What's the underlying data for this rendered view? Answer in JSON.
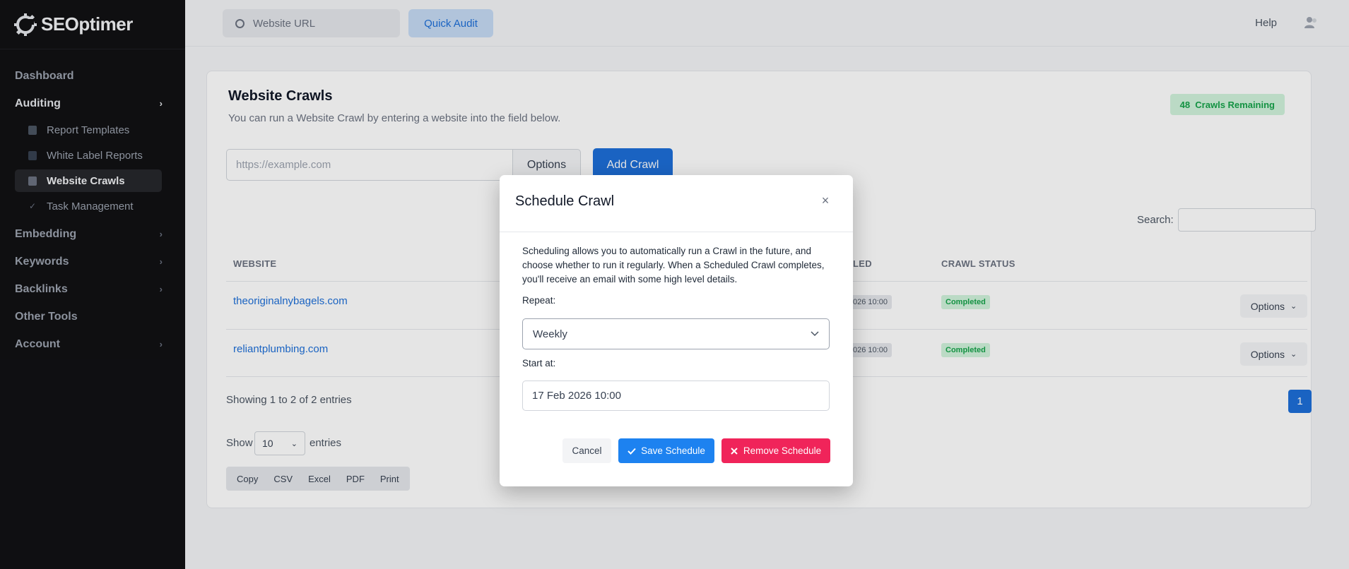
{
  "brand": {
    "name": "SEOptimer"
  },
  "sidebar": {
    "items": [
      {
        "label": "Dashboard"
      },
      {
        "label": "Auditing"
      },
      {
        "label": "Embedding"
      },
      {
        "label": "Keywords"
      },
      {
        "label": "Backlinks"
      },
      {
        "label": "Other Tools"
      },
      {
        "label": "Account"
      }
    ],
    "auditing_sub": [
      {
        "label": "Report Templates",
        "icon": "brush-icon"
      },
      {
        "label": "White Label Reports",
        "icon": "document-icon"
      },
      {
        "label": "Website Crawls",
        "icon": "crawl-search-icon"
      },
      {
        "label": "Task Management",
        "icon": "check-icon"
      }
    ]
  },
  "topbar": {
    "search_placeholder": "Website URL",
    "quick_audit_label": "Quick Audit",
    "help_label": "Help"
  },
  "page": {
    "title": "Website Crawls",
    "subtitle": "You can run a Website Crawl by entering a website into the field below.",
    "remaining_count": "48",
    "remaining_label": "Crawls Remaining",
    "url_placeholder": "https://example.com",
    "options_label": "Options",
    "add_crawl_label": "Add Crawl"
  },
  "table": {
    "search_label": "Search:",
    "columns": {
      "website": "WEBSITE",
      "scheduled_partial": "LED",
      "crawl_status": "CRAWL STATUS"
    },
    "rows": [
      {
        "website": "theoriginalnybagels.com",
        "scheduled_partial": "026 10:00",
        "status": "Completed",
        "options": "Options"
      },
      {
        "website": "reliantplumbing.com",
        "scheduled_partial": "026 10:00",
        "status": "Completed",
        "options": "Options"
      }
    ],
    "showing_text": "Showing 1 to 2 of 2 entries",
    "page_number": "1",
    "show_label": "Show",
    "page_length": "10",
    "entries_label": "entries",
    "export_buttons": [
      "Copy",
      "CSV",
      "Excel",
      "PDF",
      "Print"
    ]
  },
  "modal": {
    "title": "Schedule Crawl",
    "description": "Scheduling allows you to automatically run a Crawl in the future, and choose whether to run it regularly. When a Scheduled Crawl completes, you'll receive an email with some high level details.",
    "repeat_label": "Repeat:",
    "repeat_value": "Weekly",
    "start_label": "Start at:",
    "start_value": "17 Feb 2026 10:00",
    "cancel_label": "Cancel",
    "save_label": "Save Schedule",
    "remove_label": "Remove Schedule"
  },
  "colors": {
    "primary": "#1d6fd8",
    "save": "#1d82f0",
    "danger": "#f0245a",
    "success_text": "#16a34a",
    "success_bg": "#d1f3dc",
    "sidebar_bg": "#111114"
  }
}
